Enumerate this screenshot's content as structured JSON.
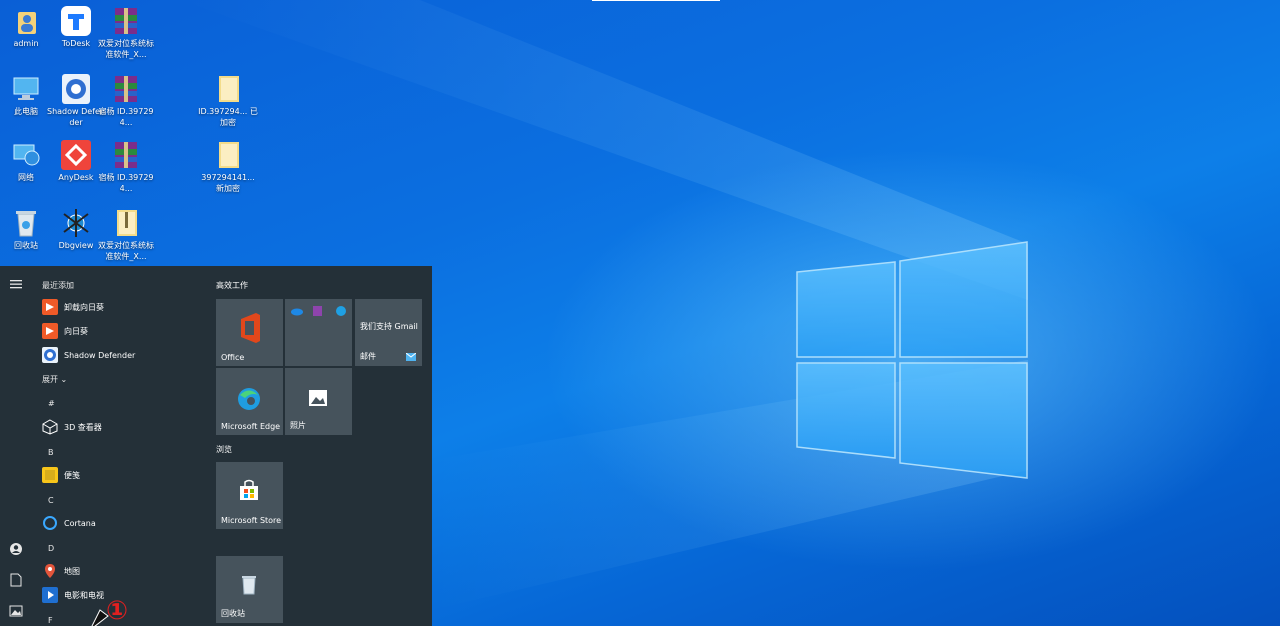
{
  "desktop": {
    "icons": [
      {
        "label": "admin",
        "icon": "user-folder-icon"
      },
      {
        "label": "ToDesk",
        "icon": "todesk-icon"
      },
      {
        "label": "双爱对位系统标准软件_X...",
        "icon": "winrar-archive-icon"
      },
      {
        "label": "此电脑",
        "icon": "this-pc-icon"
      },
      {
        "label": "Shadow Defender",
        "icon": "shadow-defender-icon"
      },
      {
        "label": "宿杨 ID.397294...",
        "icon": "winrar-archive-icon"
      },
      {
        "label": "ID.397294... 已加密",
        "icon": "folder-icon"
      },
      {
        "label": "网络",
        "icon": "network-icon"
      },
      {
        "label": "AnyDesk",
        "icon": "anydesk-icon"
      },
      {
        "label": "宿杨 ID.397294...",
        "icon": "winrar-archive-icon"
      },
      {
        "label": "397294141... 新加密",
        "icon": "folder-icon"
      },
      {
        "label": "回收站",
        "icon": "recycle-bin-icon"
      },
      {
        "label": "Dbgview",
        "icon": "dbgview-icon"
      },
      {
        "label": "双爱对位系统标准软件_X...",
        "icon": "folder-zip-icon"
      }
    ]
  },
  "start_menu": {
    "rail": {
      "menu_icon": "hamburger-icon",
      "user_icon": "user-icon",
      "docs_icon": "document-icon",
      "pictures_icon": "pictures-icon"
    },
    "recent_header": "最近添加",
    "recent": [
      {
        "label": "卸载向日葵",
        "icon": "sunlogin-icon",
        "color": "#f05a28"
      },
      {
        "label": "向日葵",
        "icon": "sunlogin-icon",
        "color": "#f05a28"
      },
      {
        "label": "Shadow Defender",
        "icon": "shadow-defender-icon",
        "color": "#2f6fd1"
      }
    ],
    "expand_label": "展开",
    "letters": [
      "#",
      "B",
      "C",
      "D",
      "F"
    ],
    "apps": [
      {
        "label": "3D 查看器",
        "icon": "cube-icon",
        "color": "#243038"
      },
      {
        "label": "便笺",
        "icon": "sticky-notes-icon",
        "color": "#f7c51a"
      },
      {
        "label": "Cortana",
        "icon": "cortana-icon",
        "color": "#243038"
      },
      {
        "label": "地图",
        "icon": "maps-icon",
        "color": "#e3553b"
      },
      {
        "label": "电影和电视",
        "icon": "movies-tv-icon",
        "color": "#1f6fd1"
      }
    ],
    "sections": {
      "productivity": "高效工作",
      "browse": "浏览"
    },
    "tiles": {
      "office": "Office",
      "gmail": "我们支持 Gmail",
      "mail": "邮件",
      "edge": "Microsoft Edge",
      "photos": "照片",
      "store": "Microsoft Store",
      "recycle": "回收站"
    },
    "annotation": "①"
  }
}
